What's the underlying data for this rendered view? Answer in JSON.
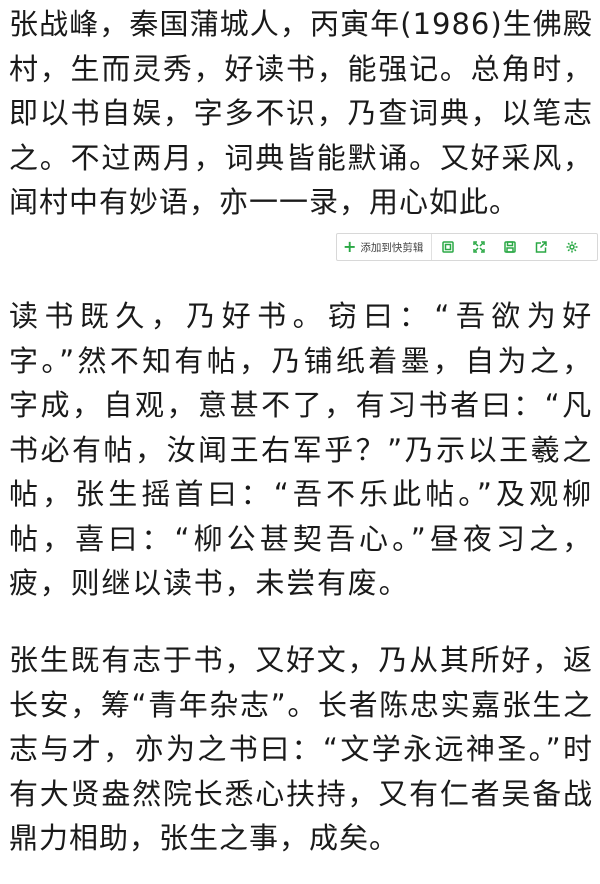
{
  "article": {
    "paragraphs": [
      "张战峰，秦国蒲城人，丙寅年(1986)生佛殿村，生而灵秀，好读书，能强记。总角时，即以书自娱，字多不识，乃查词典，以笔志之。不过两月，词典皆能默诵。又好采风，闻村中有妙语，亦一一录，用心如此。",
      "读书既久，乃好书。窃曰：“吾欲为好字。”然不知有帖，乃铺纸着墨，自为之，字成，自观，意甚不了，有习书者曰：“凡书必有帖，汝闻王右军乎？”乃示以王羲之帖，张生摇首曰：“吾不乐此帖。”及观柳帖，喜曰：“柳公甚契吾心。”昼夜习之，疲，则继以读书，未尝有废。",
      "张生既有志于书，又好文，乃从其所好，返长安，筹“青年杂志”。长者陈忠实嘉张生之志与才，亦为之书曰：“文学永远神圣。”时有大贤盎然院长悉心扶持，又有仁者吴备战鼎力相助，张生之事，成矣。"
    ]
  },
  "toolbar": {
    "add_label": "添加到快剪辑",
    "add_icon": "plus-icon",
    "icons": [
      "window-icon",
      "fullscreen-icon",
      "save-icon",
      "share-icon",
      "settings-icon"
    ],
    "accent_color": "#2aa845"
  }
}
